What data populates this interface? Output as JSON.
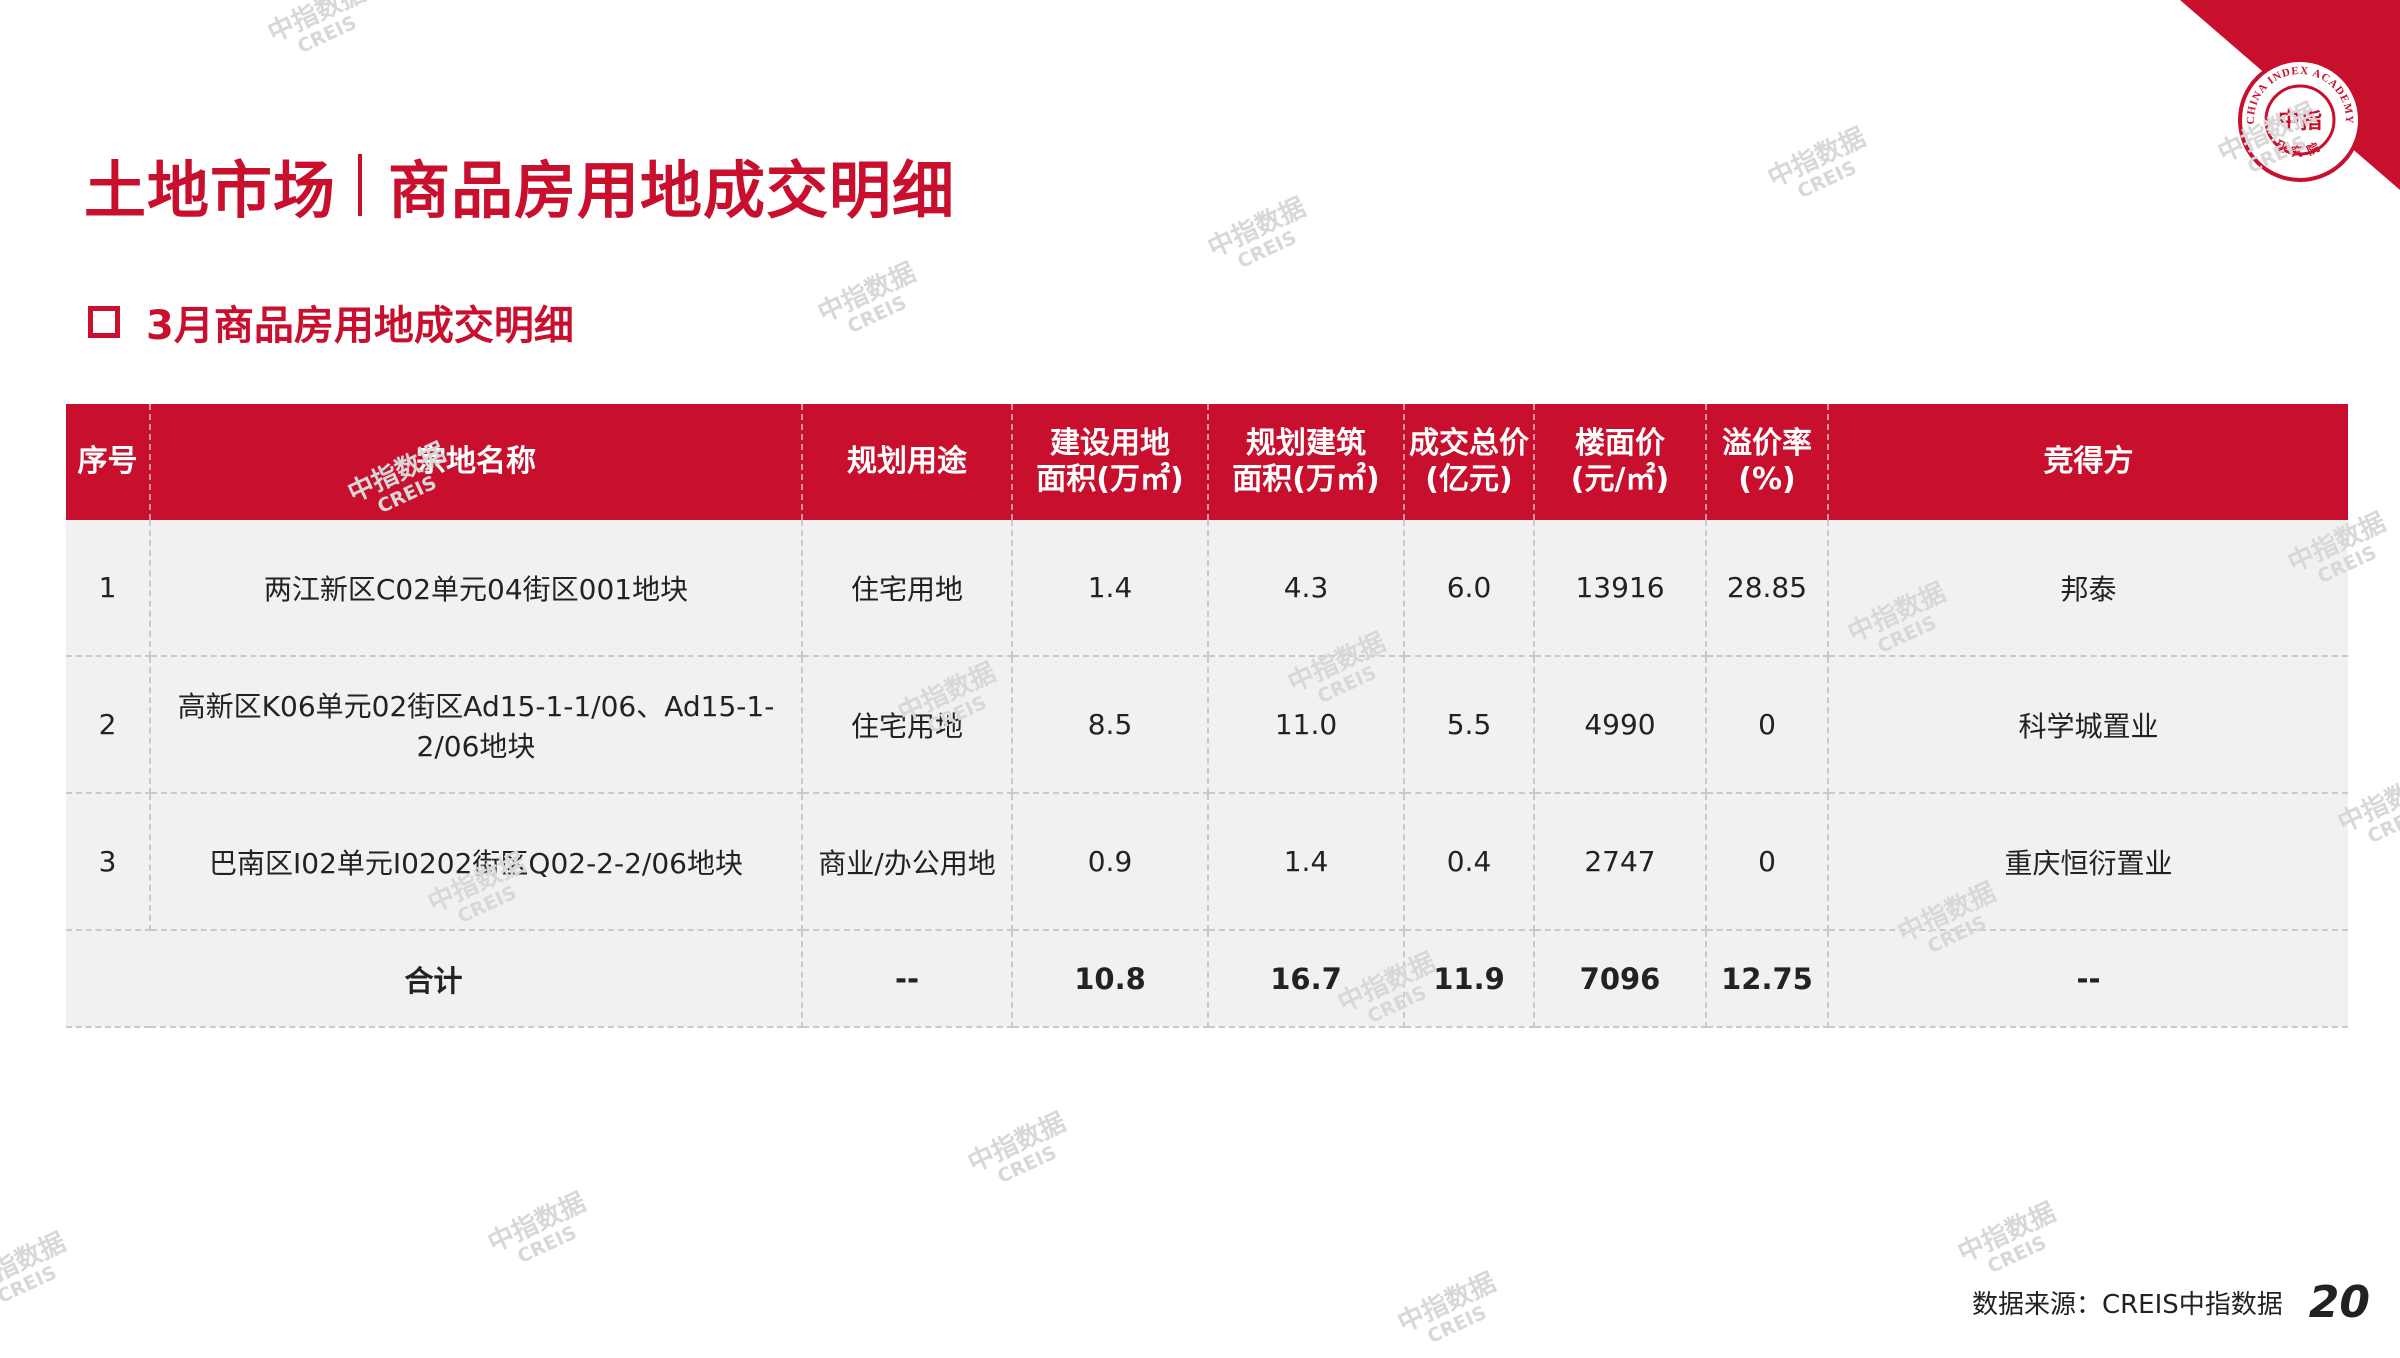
{
  "header": {
    "title_left": "土地市场",
    "title_right": "商品房用地成交明细",
    "subtitle": "3月商品房用地成交明细"
  },
  "logo": {
    "ring_text": "CHINA INDEX ACADEMY",
    "center_text": "中指",
    "bottom_text": "研究院",
    "color": "#c8102e"
  },
  "colors": {
    "accent": "#c8102e",
    "row_bg": "#f1f1f1"
  },
  "table": {
    "headers": [
      "序号",
      "宗地名称",
      "规划用途",
      "建设用地\n面积(万㎡)",
      "规划建筑\n面积(万㎡)",
      "成交总价\n(亿元)",
      "楼面价\n(元/㎡)",
      "溢价率\n(%)",
      "竞得方"
    ],
    "rows": [
      [
        "1",
        "两江新区C02单元04街区001地块",
        "住宅用地",
        "1.4",
        "4.3",
        "6.0",
        "13916",
        "28.85",
        "邦泰"
      ],
      [
        "2",
        "高新区K06单元02街区Ad15-1-1/06、Ad15-1-2/06地块",
        "住宅用地",
        "8.5",
        "11.0",
        "5.5",
        "4990",
        "0",
        "科学城置业"
      ],
      [
        "3",
        "巴南区I02单元I0202街区Q02-2-2/06地块",
        "商业/办公用地",
        "0.9",
        "1.4",
        "0.4",
        "2747",
        "0",
        "重庆恒衍置业"
      ]
    ],
    "total": [
      "合计",
      "--",
      "10.8",
      "16.7",
      "11.9",
      "7096",
      "12.75",
      "--"
    ]
  },
  "watermark": {
    "cn": "中指数据",
    "en": "CREIS"
  },
  "footer": {
    "source": "数据来源：CREIS中指数据",
    "page_number": "20"
  }
}
